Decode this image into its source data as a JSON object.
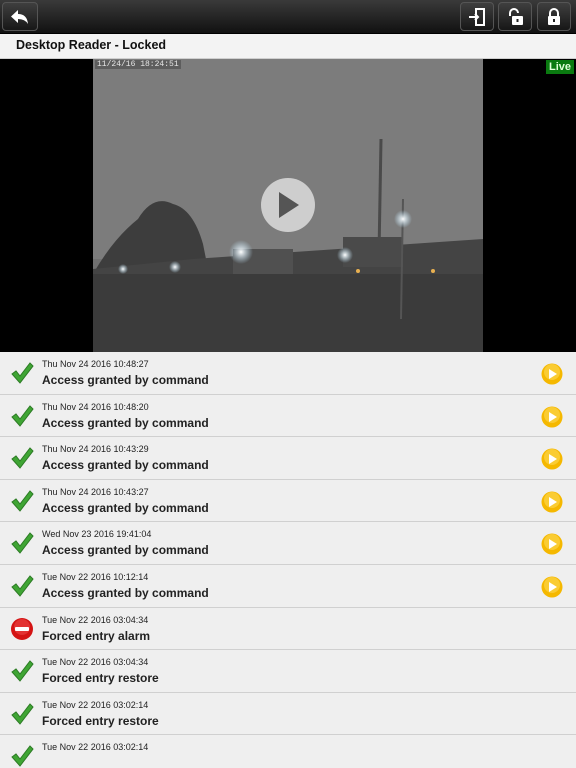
{
  "header": {
    "back_icon": "back-arrow-icon",
    "actions": [
      {
        "name": "door-exit-icon"
      },
      {
        "name": "unlock-icon"
      },
      {
        "name": "lock-icon"
      }
    ]
  },
  "title": "Desktop Reader - Locked",
  "video": {
    "timestamp": "11/24/16 18:24:51",
    "live_label": "Live"
  },
  "events": [
    {
      "date": "Thu Nov 24 2016 10:48:27",
      "description": "Access granted by command",
      "status": "granted",
      "has_video": true
    },
    {
      "date": "Thu Nov 24 2016 10:48:20",
      "description": "Access granted by command",
      "status": "granted",
      "has_video": true
    },
    {
      "date": "Thu Nov 24 2016 10:43:29",
      "description": "Access granted by command",
      "status": "granted",
      "has_video": true
    },
    {
      "date": "Thu Nov 24 2016 10:43:27",
      "description": "Access granted by command",
      "status": "granted",
      "has_video": true
    },
    {
      "date": "Wed Nov 23 2016 19:41:04",
      "description": "Access granted by command",
      "status": "granted",
      "has_video": true
    },
    {
      "date": "Tue Nov 22 2016 10:12:14",
      "description": "Access granted by command",
      "status": "granted",
      "has_video": true
    },
    {
      "date": "Tue Nov 22 2016 03:04:34",
      "description": "Forced entry alarm",
      "status": "alarm",
      "has_video": false
    },
    {
      "date": "Tue Nov 22 2016 03:04:34",
      "description": "Forced entry restore",
      "status": "granted",
      "has_video": false
    },
    {
      "date": "Tue Nov 22 2016 03:02:14",
      "description": "Forced entry restore",
      "status": "granted",
      "has_video": false
    },
    {
      "date": "Tue Nov 22 2016 03:02:14",
      "description": "",
      "status": "granted",
      "has_video": false
    }
  ],
  "colors": {
    "granted": "#3fa534",
    "alarm": "#d41414",
    "play": "#f5b800",
    "live": "#0a7a10"
  }
}
